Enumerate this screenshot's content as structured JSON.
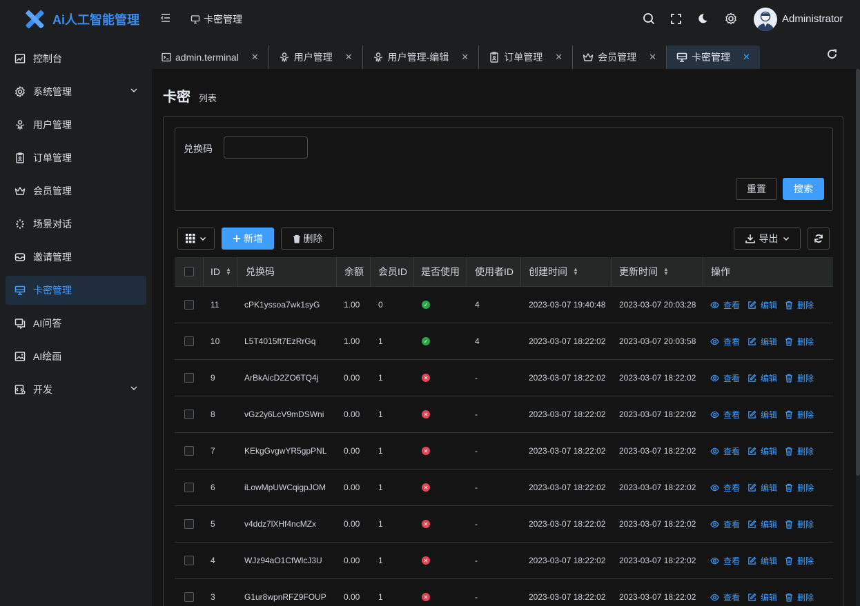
{
  "app": {
    "title": "Ai人工智能管理"
  },
  "header": {
    "current": "卡密管理",
    "user": "Administrator"
  },
  "sidebar": {
    "items": [
      {
        "label": "控制台",
        "icon": "dashboard-icon"
      },
      {
        "label": "系统管理",
        "icon": "gear-icon",
        "expandable": true
      },
      {
        "label": "用户管理",
        "icon": "user-icon"
      },
      {
        "label": "订单管理",
        "icon": "order-icon"
      },
      {
        "label": "会员管理",
        "icon": "crown-icon"
      },
      {
        "label": "场景对话",
        "icon": "scene-icon"
      },
      {
        "label": "邀请管理",
        "icon": "invite-icon"
      },
      {
        "label": "卡密管理",
        "icon": "card-icon",
        "active": true
      },
      {
        "label": "AI问答",
        "icon": "chat-icon"
      },
      {
        "label": "AI绘画",
        "icon": "image-icon"
      },
      {
        "label": "开发",
        "icon": "dev-icon",
        "expandable": true
      }
    ]
  },
  "tabs": [
    {
      "label": "admin.terminal",
      "icon": "terminal-icon"
    },
    {
      "label": "用户管理",
      "icon": "user-icon"
    },
    {
      "label": "用户管理-编辑",
      "icon": "user-icon"
    },
    {
      "label": "订单管理",
      "icon": "order-icon"
    },
    {
      "label": "会员管理",
      "icon": "crown-icon"
    },
    {
      "label": "卡密管理",
      "icon": "card-icon",
      "active": true
    }
  ],
  "page": {
    "title": "卡密",
    "subtitle": "列表"
  },
  "search": {
    "label": "兑换码",
    "value": "",
    "reset": "重置",
    "submit": "搜索"
  },
  "toolbar": {
    "add": "新增",
    "delete": "删除",
    "export": "导出"
  },
  "table": {
    "headers": [
      "ID",
      "兑换码",
      "余额",
      "会员ID",
      "是否使用",
      "使用者ID",
      "创建时间",
      "更新时间",
      "操作"
    ],
    "actions": {
      "view": "查看",
      "edit": "编辑",
      "delete": "删除"
    },
    "rows": [
      {
        "id": "11",
        "code": "cPK1yssoa7wk1syG",
        "balance": "1.00",
        "member": "0",
        "used": true,
        "user": "4",
        "created": "2023-03-07 19:40:48",
        "updated": "2023-03-07 20:03:28"
      },
      {
        "id": "10",
        "code": "L5T4015ft7EzRrGq",
        "balance": "1.00",
        "member": "1",
        "used": true,
        "user": "4",
        "created": "2023-03-07 18:22:02",
        "updated": "2023-03-07 20:03:58"
      },
      {
        "id": "9",
        "code": "ArBkAicD2ZO6TQ4j",
        "balance": "0.00",
        "member": "1",
        "used": false,
        "user": "-",
        "created": "2023-03-07 18:22:02",
        "updated": "2023-03-07 18:22:02"
      },
      {
        "id": "8",
        "code": "vGz2y6LcV9mDSWni",
        "balance": "0.00",
        "member": "1",
        "used": false,
        "user": "-",
        "created": "2023-03-07 18:22:02",
        "updated": "2023-03-07 18:22:02"
      },
      {
        "id": "7",
        "code": "KEkgGvgwYR5gpPNL",
        "balance": "0.00",
        "member": "1",
        "used": false,
        "user": "-",
        "created": "2023-03-07 18:22:02",
        "updated": "2023-03-07 18:22:02"
      },
      {
        "id": "6",
        "code": "iLowMpUWCqigpJOM",
        "balance": "0.00",
        "member": "1",
        "used": false,
        "user": "-",
        "created": "2023-03-07 18:22:02",
        "updated": "2023-03-07 18:22:02"
      },
      {
        "id": "5",
        "code": "v4ddz7lXHf4ncMZx",
        "balance": "0.00",
        "member": "1",
        "used": false,
        "user": "-",
        "created": "2023-03-07 18:22:02",
        "updated": "2023-03-07 18:22:02"
      },
      {
        "id": "4",
        "code": "WJz94aO1CfWlcJ3U",
        "balance": "0.00",
        "member": "1",
        "used": false,
        "user": "-",
        "created": "2023-03-07 18:22:02",
        "updated": "2023-03-07 18:22:02"
      },
      {
        "id": "3",
        "code": "G1ur8wpnRFZ9FOUP",
        "balance": "0.00",
        "member": "1",
        "used": false,
        "user": "-",
        "created": "2023-03-07 18:22:02",
        "updated": "2023-03-07 18:22:02"
      }
    ]
  },
  "colors": {
    "accent": "#409eff",
    "brand": "#3b8ef0",
    "ok": "#29a745",
    "no": "#e04756"
  }
}
